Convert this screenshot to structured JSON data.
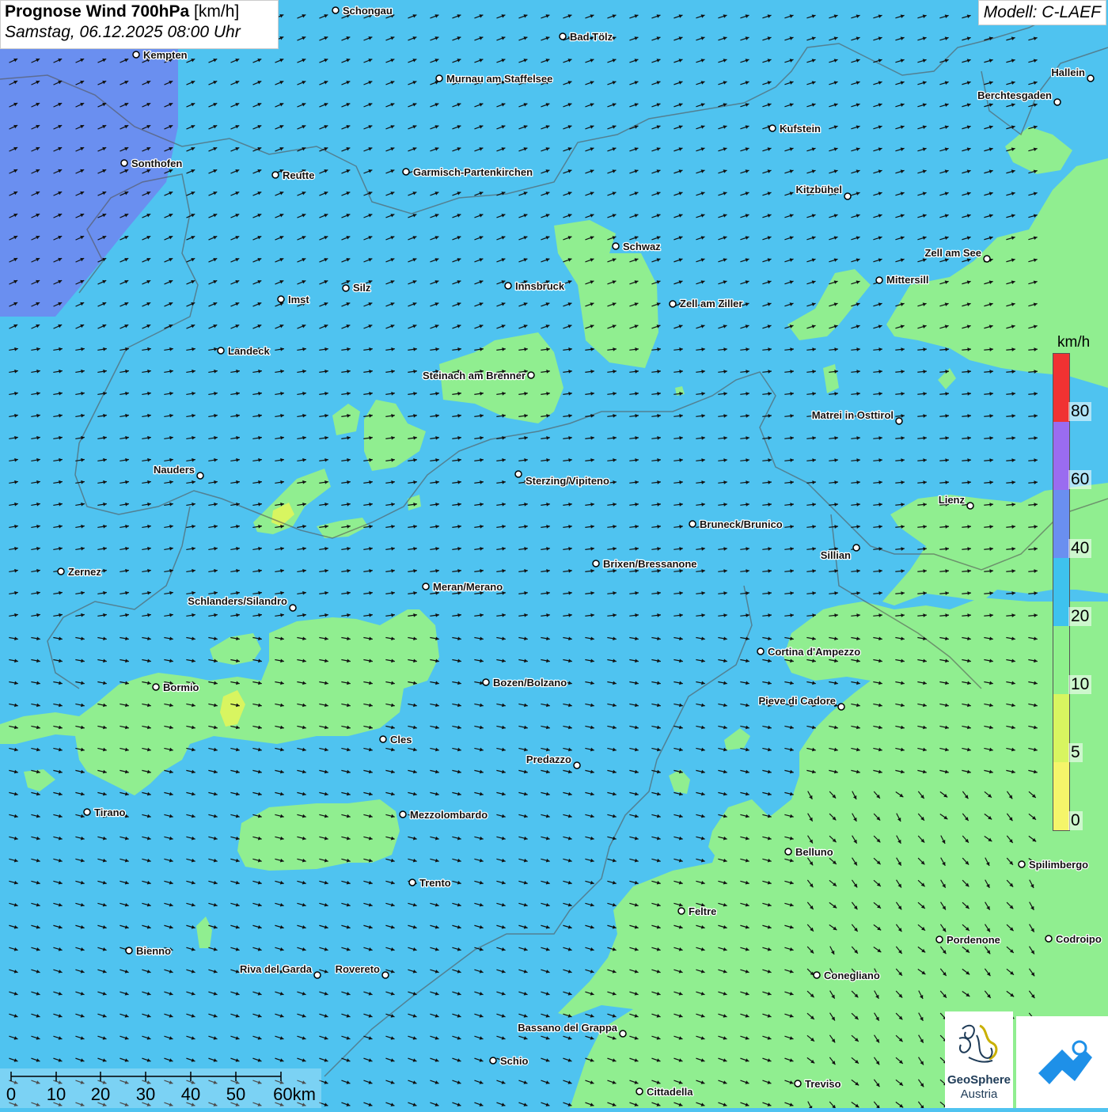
{
  "title": {
    "product": "Prognose Wind 700hPa",
    "unit": "[km/h]",
    "datetime": "Samstag, 06.12.2025 08:00 Uhr"
  },
  "model_label": "Modell: C-LAEF",
  "legend": {
    "unit": "km/h",
    "ticks": [
      "80",
      "60",
      "40",
      "20",
      "10",
      "5",
      "0"
    ],
    "colors": [
      "#f03232",
      "#9a6cf0",
      "#6a8ff0",
      "#3ec2ee",
      "#8ef08c",
      "#d8f560",
      "#f5f56a"
    ]
  },
  "scalebar": {
    "labels": [
      "0",
      "10",
      "20",
      "30",
      "40",
      "50",
      "60km"
    ]
  },
  "colors": {
    "background_wind_20_40": "#4fc3f0",
    "wind_10_20": "#90ee90",
    "wind_40_60": "#6a8ff0",
    "wind_5_10": "#d8f560"
  },
  "cities": [
    {
      "name": "Schongau"
    },
    {
      "name": "Bad Tölz"
    },
    {
      "name": "Kempten"
    },
    {
      "name": "Murnau am Staffelsee"
    },
    {
      "name": "Hallein"
    },
    {
      "name": "Berchtesgaden"
    },
    {
      "name": "Kufstein"
    },
    {
      "name": "Sonthofen"
    },
    {
      "name": "Reutte"
    },
    {
      "name": "Garmisch-Partenkirchen"
    },
    {
      "name": "Kitzbühel"
    },
    {
      "name": "Schwaz"
    },
    {
      "name": "Zell am See"
    },
    {
      "name": "Mittersill"
    },
    {
      "name": "Innsbruck"
    },
    {
      "name": "Zell am Ziller"
    },
    {
      "name": "Imst"
    },
    {
      "name": "Silz"
    },
    {
      "name": "Landeck"
    },
    {
      "name": "Steinach am Brenner"
    },
    {
      "name": "Matrei in Osttirol"
    },
    {
      "name": "Nauders"
    },
    {
      "name": "Sterzing/Vipiteno"
    },
    {
      "name": "Lienz"
    },
    {
      "name": "Bruneck/Brunico"
    },
    {
      "name": "Sillian"
    },
    {
      "name": "Zernez"
    },
    {
      "name": "Brixen/Bressanone"
    },
    {
      "name": "Meran/Merano"
    },
    {
      "name": "Schlanders/Silandro"
    },
    {
      "name": "Cortina d'Ampezzo"
    },
    {
      "name": "Bozen/Bolzano"
    },
    {
      "name": "Bormio"
    },
    {
      "name": "Pieve di Cadore"
    },
    {
      "name": "Cles"
    },
    {
      "name": "Predazzo"
    },
    {
      "name": "Tirano"
    },
    {
      "name": "Mezzolombardo"
    },
    {
      "name": "Belluno"
    },
    {
      "name": "Spilimbergo"
    },
    {
      "name": "Trento"
    },
    {
      "name": "Feltre"
    },
    {
      "name": "Pordenone"
    },
    {
      "name": "Codroipo"
    },
    {
      "name": "Bienno"
    },
    {
      "name": "Riva del Garda"
    },
    {
      "name": "Rovereto"
    },
    {
      "name": "Conegliano"
    },
    {
      "name": "Bassano del Grappa"
    },
    {
      "name": "Schio"
    },
    {
      "name": "Treviso"
    },
    {
      "name": "Cittadella"
    }
  ],
  "logos": {
    "geosphere_name": "GeoSphere",
    "geosphere_sub": "Austria"
  }
}
